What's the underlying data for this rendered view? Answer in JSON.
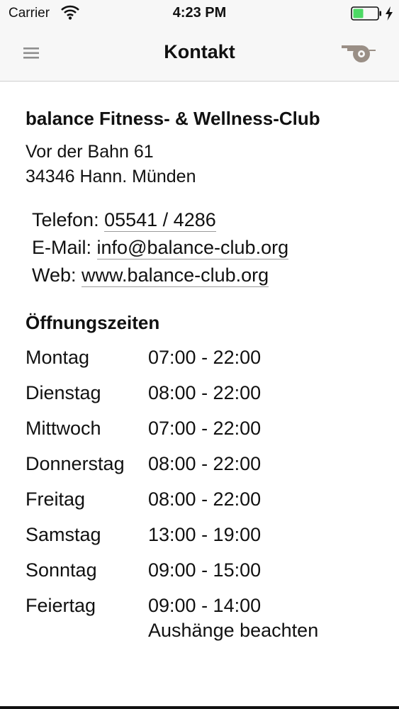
{
  "status_bar": {
    "carrier": "Carrier",
    "time": "4:23 PM"
  },
  "nav": {
    "title": "Kontakt",
    "left_icon": "menu-icon",
    "right_icon": "whistle-icon"
  },
  "club": {
    "name": "balance Fitness- & Wellness-Club",
    "address_line1": "Vor der Bahn 61",
    "address_line2": "34346 Hann. Münden"
  },
  "contact": {
    "phone_label": "Telefon:",
    "phone": "05541 / 4286",
    "email_label": "E-Mail:",
    "email": "info@balance-club.org",
    "web_label": "Web:",
    "web": "www.balance-club.org"
  },
  "hours": {
    "title": "Öffnungszeiten",
    "rows": [
      {
        "day": "Montag",
        "time": "07:00 - 22:00"
      },
      {
        "day": "Dienstag",
        "time": "08:00 - 22:00"
      },
      {
        "day": "Mittwoch",
        "time": "07:00 - 22:00"
      },
      {
        "day": "Donnerstag",
        "time": "08:00 - 22:00"
      },
      {
        "day": "Freitag",
        "time": "08:00 - 22:00"
      },
      {
        "day": "Samstag",
        "time": "13:00 - 19:00"
      },
      {
        "day": "Sonntag",
        "time": "09:00 - 15:00"
      },
      {
        "day": "Feiertag",
        "time": "09:00 - 14:00"
      }
    ],
    "note": "Aushänge beachten"
  },
  "colors": {
    "battery_fill": "#4cd964",
    "nav_background": "#f7f7f7",
    "icon_gray": "#8e8e8e",
    "whistle": "#9a8f86"
  }
}
